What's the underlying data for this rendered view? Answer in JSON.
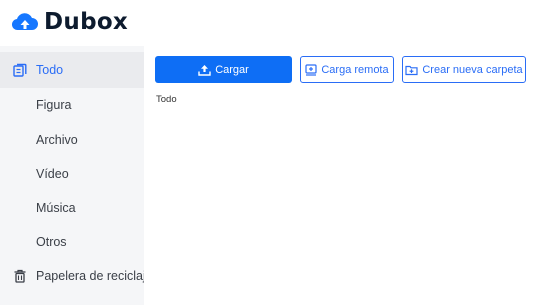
{
  "app": {
    "name": "Dubox",
    "brand_color": "#0e6ef5",
    "logo_icon": "cloud-upload-icon"
  },
  "sidebar": {
    "items": [
      {
        "label": "Todo",
        "icon": "files-icon",
        "active": true
      },
      {
        "label": "Figura"
      },
      {
        "label": "Archivo"
      },
      {
        "label": "Vídeo"
      },
      {
        "label": "Música"
      },
      {
        "label": "Otros"
      },
      {
        "label": "Papelera de reciclaje",
        "icon": "trash-icon"
      }
    ]
  },
  "toolbar": {
    "upload_label": "Cargar",
    "upload_icon": "upload-icon",
    "remote_label": "Carga remota",
    "remote_icon": "remote-upload-icon",
    "new_folder_label": "Crear nueva carpeta",
    "new_folder_icon": "new-folder-icon"
  },
  "breadcrumb": {
    "current": "Todo"
  }
}
